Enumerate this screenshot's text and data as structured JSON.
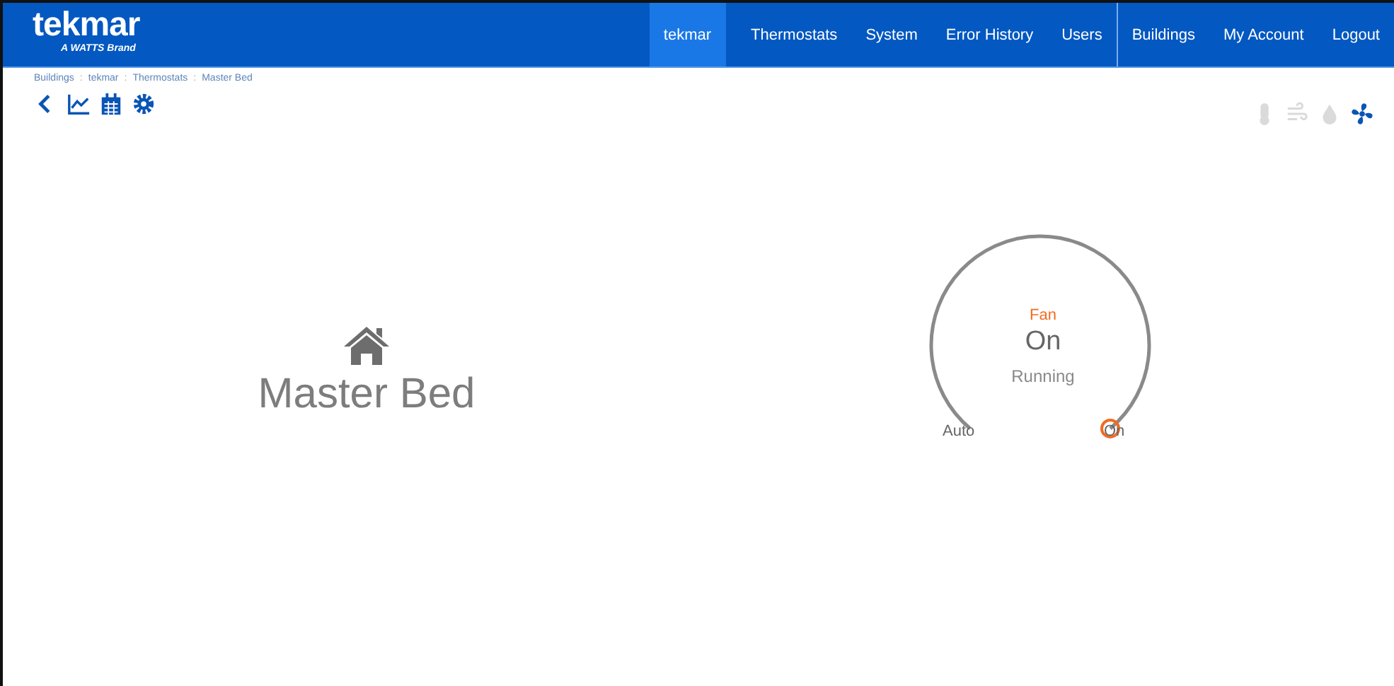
{
  "logo": {
    "name": "tekmar",
    "tagline": "A WATTS Brand"
  },
  "nav": {
    "items": [
      {
        "label": "tekmar",
        "selected": true
      },
      {
        "label": "Thermostats",
        "selected": false
      },
      {
        "label": "System",
        "selected": false
      },
      {
        "label": "Error History",
        "selected": false
      },
      {
        "label": "Users",
        "selected": false
      }
    ],
    "account_items": [
      {
        "label": "Buildings",
        "selected": false
      },
      {
        "label": "My Account",
        "selected": false
      },
      {
        "label": "Logout",
        "selected": false
      }
    ]
  },
  "breadcrumb": [
    {
      "kind": "link",
      "label": "Buildings"
    },
    {
      "kind": "separator",
      "label": ":"
    },
    {
      "kind": "link",
      "label": "tekmar"
    },
    {
      "kind": "separator",
      "label": ":"
    },
    {
      "kind": "link",
      "label": "Thermostats"
    },
    {
      "kind": "separator",
      "label": ":"
    },
    {
      "kind": "link",
      "label": "Master Bed"
    }
  ],
  "toolbar": [
    {
      "kind": "back"
    },
    {
      "kind": "chart"
    },
    {
      "kind": "calendar"
    },
    {
      "kind": "settings"
    }
  ],
  "modes": [
    {
      "kind": "thermometer",
      "active": false
    },
    {
      "kind": "air",
      "active": false
    },
    {
      "kind": "drop",
      "active": false
    },
    {
      "kind": "fan",
      "active": true
    }
  ],
  "thermostat": {
    "name": "Master Bed"
  },
  "dial": {
    "title": "Fan",
    "value": "On",
    "status": "Running",
    "options": [
      {
        "label": "Auto",
        "selected": false
      },
      {
        "label": "On",
        "selected": true
      }
    ]
  }
}
